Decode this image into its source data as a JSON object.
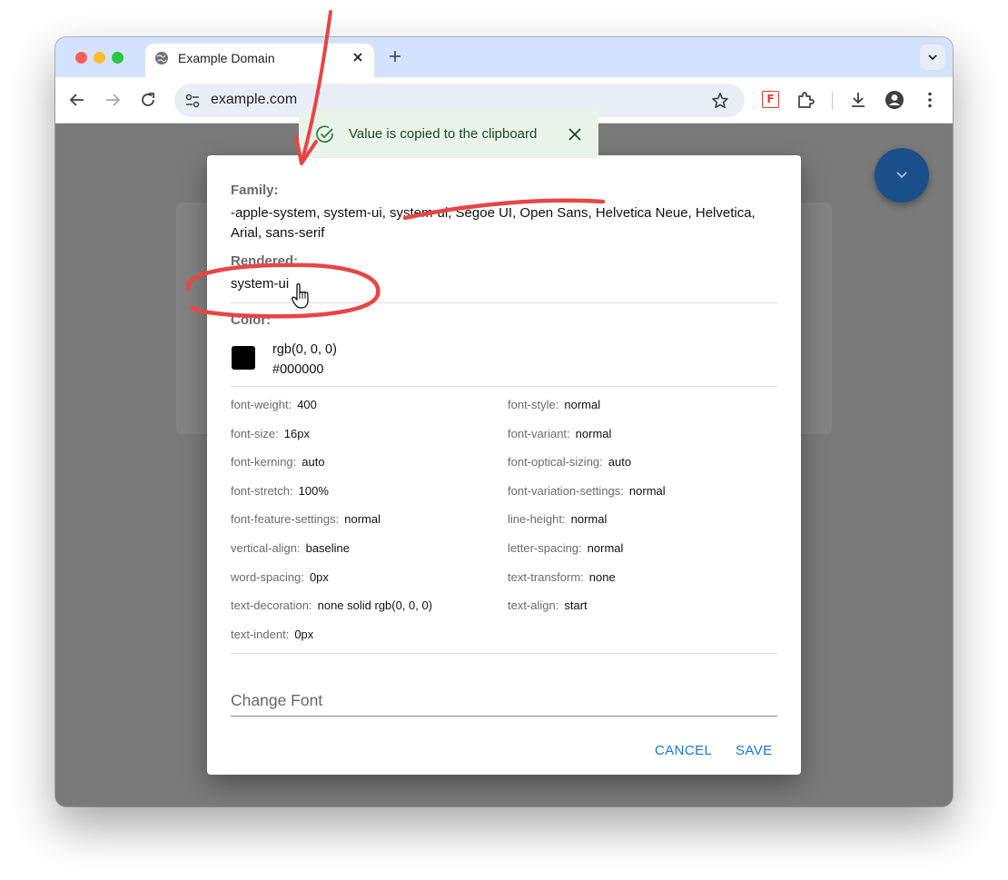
{
  "browser": {
    "tab_title": "Example Domain",
    "url": "example.com"
  },
  "dialog": {
    "family_label": "Family:",
    "family_value": "-apple-system, system-ui, system-ui, Segoe UI, Open Sans, Helvetica Neue, Helvetica, Arial, sans-serif",
    "rendered_label": "Rendered:",
    "rendered_value": "system-ui",
    "color_label": "Color:",
    "color_rgb": "rgb(0, 0, 0)",
    "color_hex": "#000000",
    "properties_left": [
      {
        "key": "font-weight:",
        "value": "400"
      },
      {
        "key": "font-size:",
        "value": "16px"
      },
      {
        "key": "font-kerning:",
        "value": "auto"
      },
      {
        "key": "font-stretch:",
        "value": "100%"
      },
      {
        "key": "font-feature-settings:",
        "value": "normal"
      },
      {
        "key": "vertical-align:",
        "value": "baseline"
      },
      {
        "key": "word-spacing:",
        "value": "0px"
      },
      {
        "key": "text-decoration:",
        "value": "none solid rgb(0, 0, 0)"
      },
      {
        "key": "text-indent:",
        "value": "0px"
      }
    ],
    "properties_right": [
      {
        "key": "font-style:",
        "value": "normal"
      },
      {
        "key": "font-variant:",
        "value": "normal"
      },
      {
        "key": "font-optical-sizing:",
        "value": "auto"
      },
      {
        "key": "font-variation-settings:",
        "value": "normal"
      },
      {
        "key": "line-height:",
        "value": "normal"
      },
      {
        "key": "letter-spacing:",
        "value": "normal"
      },
      {
        "key": "text-transform:",
        "value": "none"
      },
      {
        "key": "text-align:",
        "value": "start"
      }
    ],
    "change_font_placeholder": "Change Font",
    "cancel_label": "CANCEL",
    "save_label": "SAVE"
  },
  "snackbar": {
    "message": "Value is copied to the clipboard"
  },
  "colors": {
    "accent": "#1976d2",
    "annotation": "#e84545",
    "snackbar_bg": "#e9f4ea",
    "fab": "#1b4f8c"
  }
}
